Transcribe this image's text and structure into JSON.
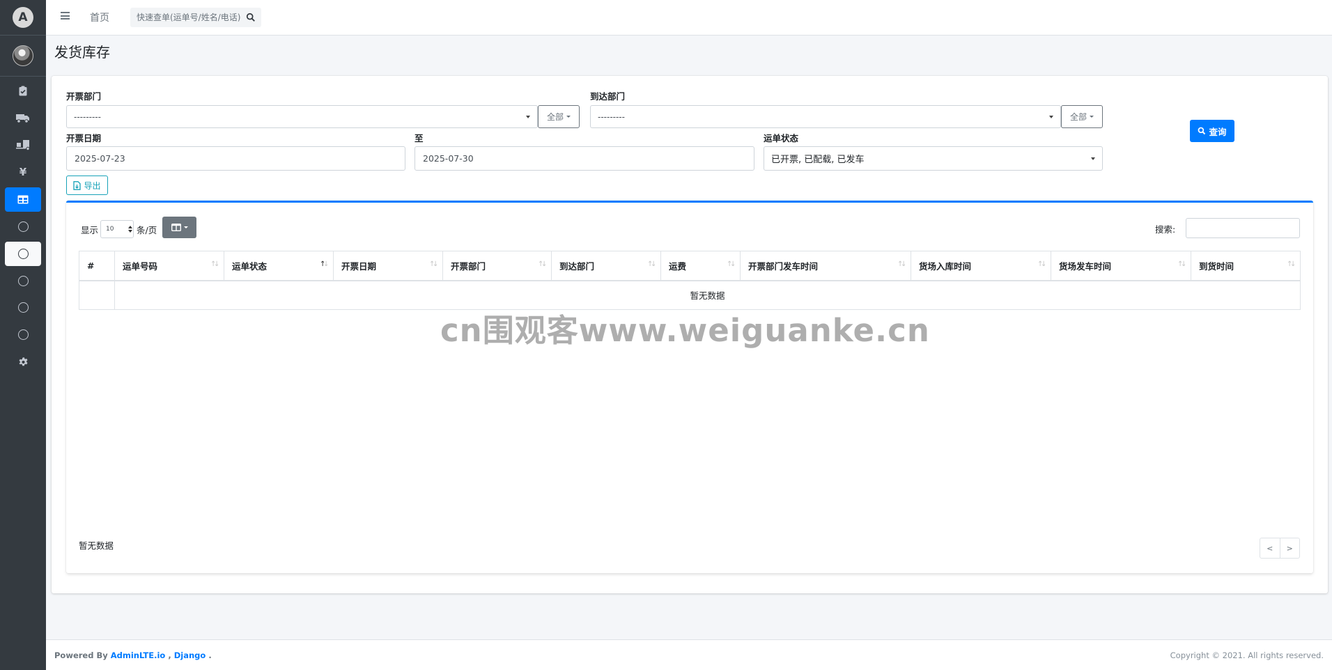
{
  "colors": {
    "primary": "#007bff",
    "sidebar": "#343a40",
    "info": "#17a2b8",
    "secondary": "#6c757d"
  },
  "sidebar": {
    "logo_letter": "A",
    "items": [
      {
        "icon": "clipboard-icon"
      },
      {
        "icon": "truck-icon"
      },
      {
        "icon": "truck-loading-icon"
      },
      {
        "icon": "yen-icon"
      },
      {
        "icon": "table-icon",
        "active": true
      },
      {
        "icon": "circle-icon"
      },
      {
        "icon": "circle-icon",
        "hover": true
      },
      {
        "icon": "circle-icon"
      },
      {
        "icon": "circle-icon"
      },
      {
        "icon": "circle-icon"
      },
      {
        "icon": "gear-icon"
      }
    ]
  },
  "topbar": {
    "home": "首页",
    "search_placeholder": "快速查单(运单号/姓名/电话)"
  },
  "page": {
    "title": "发货库存"
  },
  "filters": {
    "issue_dept_label": "开票部门",
    "issue_dept_value": "---------",
    "issue_dept_all": "全部",
    "arrive_dept_label": "到达部门",
    "arrive_dept_value": "---------",
    "arrive_dept_all": "全部",
    "date_label": "开票日期",
    "date_from": "2025-07-23",
    "to_label": "至",
    "date_to": "2025-07-30",
    "status_label": "运单状态",
    "status_value": "已开票, 已配载, 已发车",
    "query_button": "查询",
    "export_button": "导出"
  },
  "table": {
    "show_label": "显示",
    "page_length": "10",
    "per_page_label": "条/页",
    "search_label": "搜索:",
    "columns": [
      "#",
      "运单号码",
      "运单状态",
      "开票日期",
      "开票部门",
      "到达部门",
      "运费",
      "开票部门发车时间",
      "货场入库时间",
      "货场发车时间",
      "到货时间"
    ],
    "empty_text": "暂无数据",
    "info_text": "暂无数据",
    "prev": "<",
    "next": ">"
  },
  "watermark": "cn围观客www.weiguanke.cn",
  "footer": {
    "powered_by": "Powered By",
    "link1": "AdminLTE.io",
    "separator": ",",
    "link2": "Django",
    "end": ".",
    "copyright": "Copyright © 2021. All rights reserved."
  }
}
